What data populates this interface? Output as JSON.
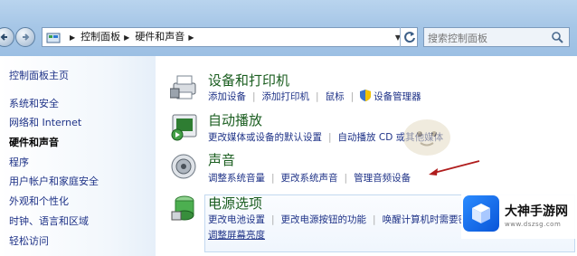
{
  "address_bar": {
    "breadcrumbs": [
      "控制面板",
      "硬件和声音"
    ],
    "search_placeholder": "搜索控制面板"
  },
  "left_nav": {
    "items": [
      {
        "label": "控制面板主页",
        "current": false
      },
      {
        "label": "系统和安全",
        "current": false
      },
      {
        "label": "网络和 Internet",
        "current": false
      },
      {
        "label": "硬件和声音",
        "current": true
      },
      {
        "label": "程序",
        "current": false
      },
      {
        "label": "用户帐户和家庭安全",
        "current": false
      },
      {
        "label": "外观和个性化",
        "current": false
      },
      {
        "label": "时钟、语言和区域",
        "current": false
      },
      {
        "label": "轻松访问",
        "current": false
      }
    ]
  },
  "categories": [
    {
      "title": "设备和打印机",
      "icon": "printer-icon",
      "links": [
        "添加设备",
        "添加打印机",
        "鼠标",
        "设备管理器"
      ]
    },
    {
      "title": "自动播放",
      "icon": "autoplay-icon",
      "links": [
        "更改媒体或设备的默认设置",
        "自动播放 CD 或其他媒体"
      ]
    },
    {
      "title": "声音",
      "icon": "speaker-icon",
      "links": [
        "调整系统音量",
        "更改系统声音",
        "管理音频设备"
      ]
    },
    {
      "title": "电源选项",
      "icon": "battery-icon",
      "links": [
        "更改电池设置",
        "更改电源按钮的功能",
        "唤醒计算机时需要密码",
        "调整屏幕亮度"
      ]
    }
  ],
  "logo": {
    "name": "大神手游网",
    "url": "www.dszsg.com"
  },
  "colors": {
    "link": "#1e3287",
    "category_title": "#1b5e20",
    "arrow": "#b01d1d"
  }
}
